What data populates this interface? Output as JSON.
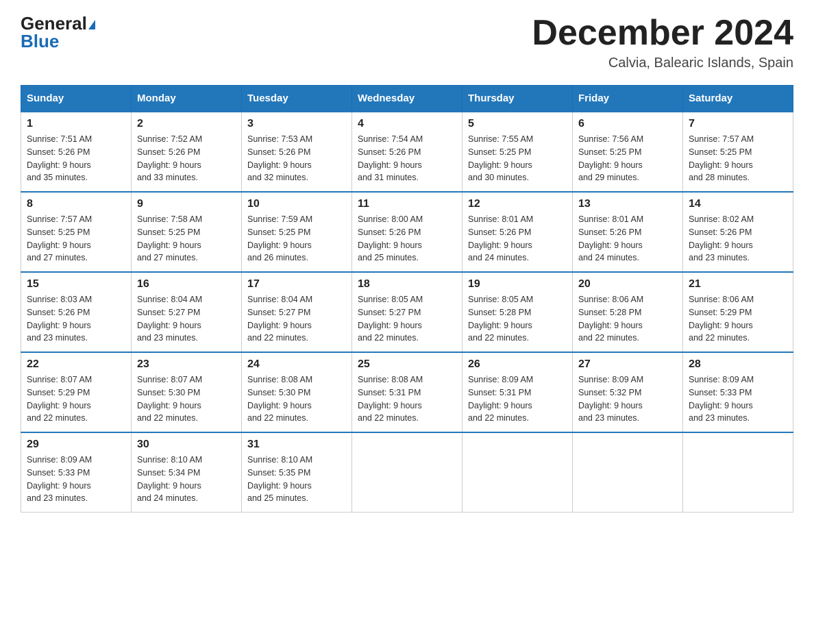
{
  "header": {
    "logo_line1": "General",
    "logo_line2": "Blue",
    "month_title": "December 2024",
    "subtitle": "Calvia, Balearic Islands, Spain"
  },
  "days_of_week": [
    "Sunday",
    "Monday",
    "Tuesday",
    "Wednesday",
    "Thursday",
    "Friday",
    "Saturday"
  ],
  "weeks": [
    [
      {
        "day": "1",
        "sunrise": "7:51 AM",
        "sunset": "5:26 PM",
        "daylight": "9 hours and 35 minutes."
      },
      {
        "day": "2",
        "sunrise": "7:52 AM",
        "sunset": "5:26 PM",
        "daylight": "9 hours and 33 minutes."
      },
      {
        "day": "3",
        "sunrise": "7:53 AM",
        "sunset": "5:26 PM",
        "daylight": "9 hours and 32 minutes."
      },
      {
        "day": "4",
        "sunrise": "7:54 AM",
        "sunset": "5:26 PM",
        "daylight": "9 hours and 31 minutes."
      },
      {
        "day": "5",
        "sunrise": "7:55 AM",
        "sunset": "5:25 PM",
        "daylight": "9 hours and 30 minutes."
      },
      {
        "day": "6",
        "sunrise": "7:56 AM",
        "sunset": "5:25 PM",
        "daylight": "9 hours and 29 minutes."
      },
      {
        "day": "7",
        "sunrise": "7:57 AM",
        "sunset": "5:25 PM",
        "daylight": "9 hours and 28 minutes."
      }
    ],
    [
      {
        "day": "8",
        "sunrise": "7:57 AM",
        "sunset": "5:25 PM",
        "daylight": "9 hours and 27 minutes."
      },
      {
        "day": "9",
        "sunrise": "7:58 AM",
        "sunset": "5:25 PM",
        "daylight": "9 hours and 27 minutes."
      },
      {
        "day": "10",
        "sunrise": "7:59 AM",
        "sunset": "5:25 PM",
        "daylight": "9 hours and 26 minutes."
      },
      {
        "day": "11",
        "sunrise": "8:00 AM",
        "sunset": "5:26 PM",
        "daylight": "9 hours and 25 minutes."
      },
      {
        "day": "12",
        "sunrise": "8:01 AM",
        "sunset": "5:26 PM",
        "daylight": "9 hours and 24 minutes."
      },
      {
        "day": "13",
        "sunrise": "8:01 AM",
        "sunset": "5:26 PM",
        "daylight": "9 hours and 24 minutes."
      },
      {
        "day": "14",
        "sunrise": "8:02 AM",
        "sunset": "5:26 PM",
        "daylight": "9 hours and 23 minutes."
      }
    ],
    [
      {
        "day": "15",
        "sunrise": "8:03 AM",
        "sunset": "5:26 PM",
        "daylight": "9 hours and 23 minutes."
      },
      {
        "day": "16",
        "sunrise": "8:04 AM",
        "sunset": "5:27 PM",
        "daylight": "9 hours and 23 minutes."
      },
      {
        "day": "17",
        "sunrise": "8:04 AM",
        "sunset": "5:27 PM",
        "daylight": "9 hours and 22 minutes."
      },
      {
        "day": "18",
        "sunrise": "8:05 AM",
        "sunset": "5:27 PM",
        "daylight": "9 hours and 22 minutes."
      },
      {
        "day": "19",
        "sunrise": "8:05 AM",
        "sunset": "5:28 PM",
        "daylight": "9 hours and 22 minutes."
      },
      {
        "day": "20",
        "sunrise": "8:06 AM",
        "sunset": "5:28 PM",
        "daylight": "9 hours and 22 minutes."
      },
      {
        "day": "21",
        "sunrise": "8:06 AM",
        "sunset": "5:29 PM",
        "daylight": "9 hours and 22 minutes."
      }
    ],
    [
      {
        "day": "22",
        "sunrise": "8:07 AM",
        "sunset": "5:29 PM",
        "daylight": "9 hours and 22 minutes."
      },
      {
        "day": "23",
        "sunrise": "8:07 AM",
        "sunset": "5:30 PM",
        "daylight": "9 hours and 22 minutes."
      },
      {
        "day": "24",
        "sunrise": "8:08 AM",
        "sunset": "5:30 PM",
        "daylight": "9 hours and 22 minutes."
      },
      {
        "day": "25",
        "sunrise": "8:08 AM",
        "sunset": "5:31 PM",
        "daylight": "9 hours and 22 minutes."
      },
      {
        "day": "26",
        "sunrise": "8:09 AM",
        "sunset": "5:31 PM",
        "daylight": "9 hours and 22 minutes."
      },
      {
        "day": "27",
        "sunrise": "8:09 AM",
        "sunset": "5:32 PM",
        "daylight": "9 hours and 23 minutes."
      },
      {
        "day": "28",
        "sunrise": "8:09 AM",
        "sunset": "5:33 PM",
        "daylight": "9 hours and 23 minutes."
      }
    ],
    [
      {
        "day": "29",
        "sunrise": "8:09 AM",
        "sunset": "5:33 PM",
        "daylight": "9 hours and 23 minutes."
      },
      {
        "day": "30",
        "sunrise": "8:10 AM",
        "sunset": "5:34 PM",
        "daylight": "9 hours and 24 minutes."
      },
      {
        "day": "31",
        "sunrise": "8:10 AM",
        "sunset": "5:35 PM",
        "daylight": "9 hours and 25 minutes."
      },
      null,
      null,
      null,
      null
    ]
  ],
  "labels": {
    "sunrise": "Sunrise:",
    "sunset": "Sunset:",
    "daylight": "Daylight:"
  }
}
